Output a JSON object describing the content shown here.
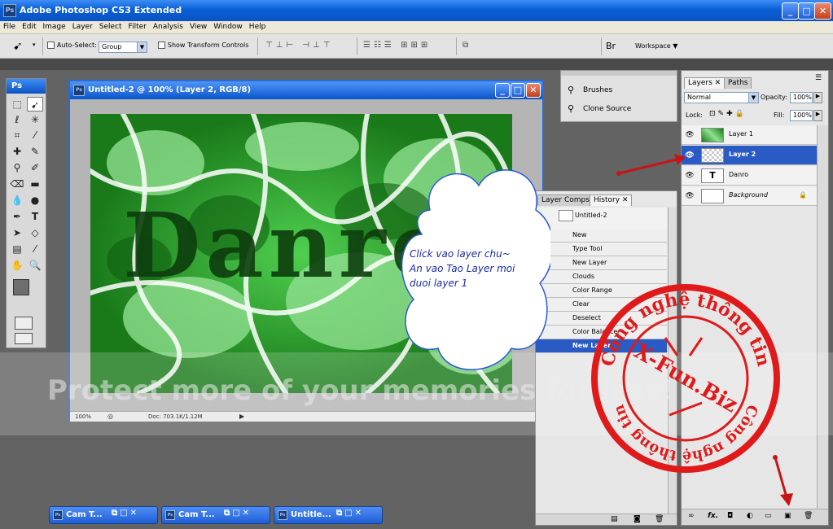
{
  "window": {
    "title": "Adobe Photoshop CS3 Extended",
    "min": "_",
    "max": "□",
    "close": "✕"
  },
  "menu": [
    "File",
    "Edit",
    "Image",
    "Layer",
    "Select",
    "Filter",
    "Analysis",
    "View",
    "Window",
    "Help"
  ],
  "options": {
    "auto_select_label": "Auto-Select:",
    "auto_select_value": "Group",
    "show_transform_label": "Show Transform Controls",
    "workspace_label": "Workspace ▼"
  },
  "toolbox": {
    "title": "Ps"
  },
  "document": {
    "title": "Untitled-2 @ 100% (Layer 2, RGB/8)",
    "zoom": "100%",
    "doc_info": "Doc: 703.1K/1.12M"
  },
  "brush_panel": {
    "items": [
      "Brushes",
      "Clone Source"
    ]
  },
  "history_panel": {
    "tabs": [
      "Layer Comps",
      "History"
    ],
    "snapshot": "Untitled-2",
    "items": [
      "New",
      "Type Tool",
      "New Layer",
      "Clouds",
      "Color Range",
      "Clear",
      "Deselect",
      "Color Balance",
      "New Layer"
    ]
  },
  "layers_panel": {
    "tabs": [
      "Layers",
      "Paths"
    ],
    "blend_mode": "Normal",
    "opacity_label": "Opacity:",
    "opacity_value": "100%",
    "lock_label": "Lock:",
    "fill_label": "Fill:",
    "fill_value": "100%",
    "layers": [
      {
        "name": "Layer 1"
      },
      {
        "name": "Layer 2"
      },
      {
        "name": "Danro"
      },
      {
        "name": "Background"
      }
    ]
  },
  "taskbar": [
    "Cam T...",
    "Cam T...",
    "Untitle..."
  ],
  "annotation": {
    "line1": "Click vao layer chu~",
    "line2": "An vao Tao Layer moi",
    "line3": "duoi layer 1"
  },
  "canvas_text": "Danro",
  "watermark": "Protect more of your memories for less!",
  "stamp": {
    "top": "Công nghệ thông tin",
    "center": "X-Fun.Biz",
    "bottom": "Công nghệ thông tin"
  },
  "colors": {
    "accent": "#2a5ac4",
    "titlebar": "#0a5fd6",
    "annotation_text": "#1a2aa8",
    "stamp_red": "#e01a1a",
    "arrow": "#c81414"
  }
}
